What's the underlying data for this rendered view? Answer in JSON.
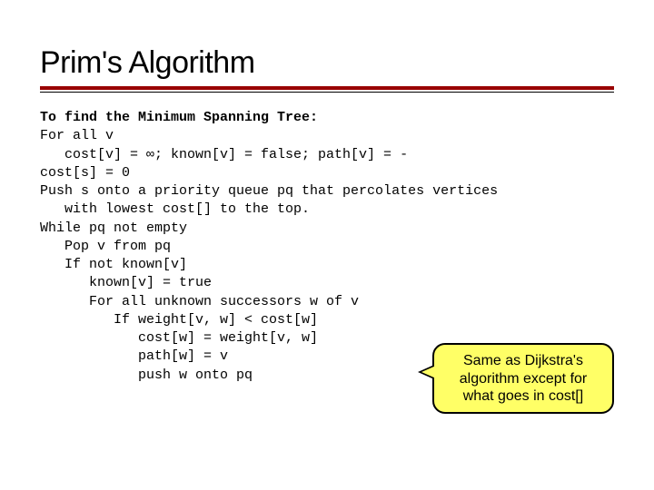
{
  "title": "Prim's Algorithm",
  "code": {
    "l1": "To find the Minimum Spanning Tree:",
    "l2": "For all v",
    "l3": "   cost[v] = ∞; known[v] = false; path[v] = -",
    "l4": "cost[s] = 0",
    "l5": "Push s onto a priority queue pq that percolates vertices",
    "l6": "   with lowest cost[] to the top.",
    "l7": "While pq not empty",
    "l8": "   Pop v from pq",
    "l9": "   If not known[v]",
    "l10": "      known[v] = true",
    "l11": "      For all unknown successors w of v",
    "l12": "         If weight[v, w] < cost[w]",
    "l13": "            cost[w] = weight[v, w]",
    "l14": "            path[w] = v",
    "l15": "            push w onto pq"
  },
  "callout_text": "Same as Dijkstra's algorithm except for what goes in cost[]"
}
